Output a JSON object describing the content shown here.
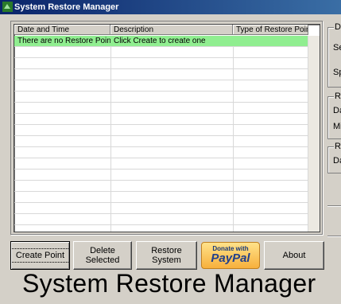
{
  "window": {
    "title": "System Restore Manager"
  },
  "listview": {
    "columns": [
      "Date and Time",
      "Description",
      "Type of Restore Point"
    ],
    "rows": [
      [
        "There are no Restore Points",
        "Click Create to create one",
        ""
      ]
    ],
    "selected_row_color": "#90ee90"
  },
  "side_groups": {
    "group1": {
      "label": "Di",
      "lines": [
        "Se",
        "Sp"
      ]
    },
    "group2": {
      "label": "Re",
      "lines": [
        "Da",
        "Mi"
      ]
    },
    "group3": {
      "label": "Re",
      "lines": [
        "Da"
      ]
    }
  },
  "buttons": {
    "create": "Create Point",
    "delete": "Delete\nSelected",
    "restore": "Restore\nSystem",
    "donate_top": "Donate with",
    "donate_brand": "PayPal",
    "about": "About"
  },
  "banner": {
    "text": "System Restore Manager"
  },
  "icons": {
    "title_icon": "restore-icon"
  }
}
